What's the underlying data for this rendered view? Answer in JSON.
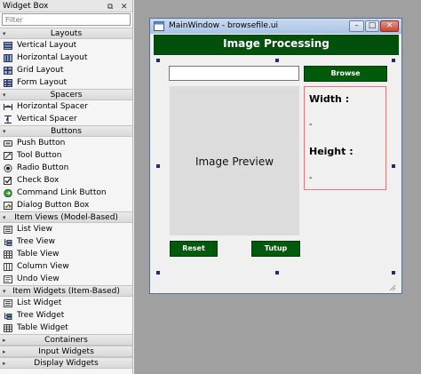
{
  "widget_box": {
    "title": "Widget Box",
    "filter_placeholder": "Filter",
    "categories": [
      {
        "label": "Layouts",
        "items": [
          "Vertical Layout",
          "Horizontal Layout",
          "Grid Layout",
          "Form Layout"
        ]
      },
      {
        "label": "Spacers",
        "items": [
          "Horizontal Spacer",
          "Vertical Spacer"
        ]
      },
      {
        "label": "Buttons",
        "items": [
          "Push Button",
          "Tool Button",
          "Radio Button",
          "Check Box",
          "Command Link Button",
          "Dialog Button Box"
        ]
      },
      {
        "label": "Item Views (Model-Based)",
        "items": [
          "List View",
          "Tree View",
          "Table View",
          "Column View",
          "Undo View"
        ]
      },
      {
        "label": "Item Widgets (Item-Based)",
        "items": [
          "List Widget",
          "Tree Widget",
          "Table Widget"
        ]
      },
      {
        "label": "Containers"
      },
      {
        "label": "Input Widgets"
      },
      {
        "label": "Display Widgets"
      }
    ]
  },
  "window": {
    "title": "MainWindow - browsefile.ui",
    "header": "Image Processing",
    "browse_label": "Browse",
    "path_value": "",
    "preview_text": "Image Preview",
    "width_label": "Width :",
    "width_value": "-",
    "height_label": "Height :",
    "height_value": "-",
    "reset_label": "Reset",
    "tutup_label": "Tutup"
  },
  "colors": {
    "header_bg": "#004f0a",
    "button_bg": "#005a0b",
    "info_border": "#e07a7a",
    "mdi_bg": "#a0a0a0"
  }
}
